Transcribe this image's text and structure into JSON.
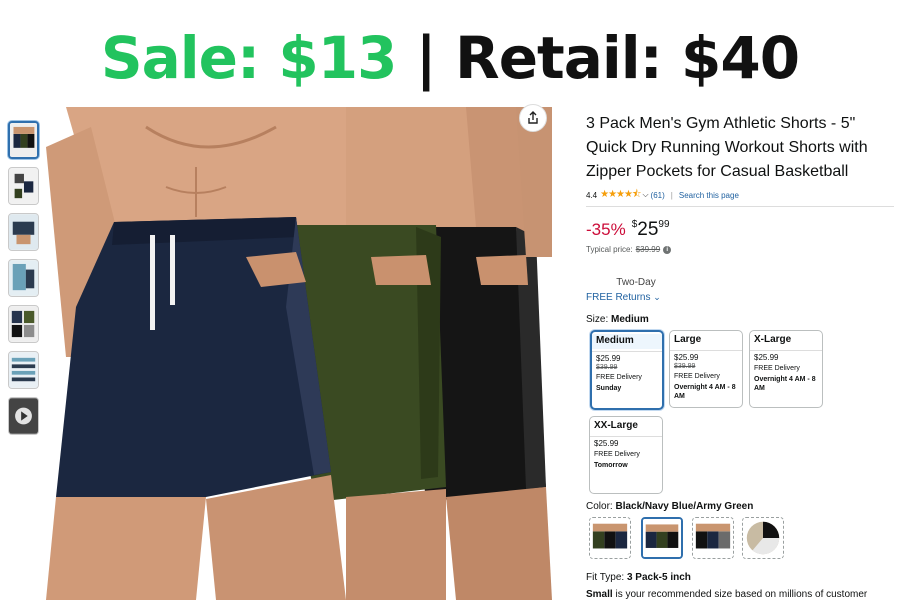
{
  "banner": {
    "sale": "Sale: $13",
    "separator": "|",
    "retail": "Retail: $40",
    "sale_color": "#22c35e",
    "retail_color": "#111111"
  },
  "product": {
    "title": "3 Pack Men's Gym Athletic Shorts - 5\" Quick Dry Running Workout Shorts with Zipper Pockets for Casual Basketball",
    "rating": "4.4",
    "stars": "★★★★⯪",
    "reviews": "(61)",
    "rating_separator": "|",
    "search_link": "Search this page",
    "discount": "-35%",
    "price_symbol": "$",
    "price_whole": "25",
    "price_cents": "99",
    "typical_label": "Typical price:",
    "typical_price": "$39.99",
    "info_icon": "i",
    "shipping_label": "Two-Day",
    "returns_label": "FREE Returns",
    "accent_color": "#2162a1",
    "discount_color": "#cc0c39"
  },
  "size": {
    "label": "Size:",
    "selected": "Medium",
    "options": [
      {
        "name": "Medium",
        "price": "$25.99",
        "original": "$39.99",
        "delivery": "FREE Delivery",
        "when": "Sunday"
      },
      {
        "name": "Large",
        "price": "$25.99",
        "original": "$39.99",
        "delivery": "FREE Delivery",
        "when": "Overnight 4 AM - 8 AM"
      },
      {
        "name": "X-Large",
        "price": "$25.99",
        "original": "",
        "delivery": "FREE Delivery",
        "when": "Overnight 4 AM - 8 AM"
      },
      {
        "name": "XX-Large",
        "price": "$25.99",
        "original": "",
        "delivery": "FREE Delivery",
        "when": "Tomorrow"
      }
    ]
  },
  "color": {
    "label": "Color:",
    "selected": "Black/Navy Blue/Army Green",
    "swatches": [
      "black-green-navy",
      "black-navy-green",
      "black-navy-grey",
      "black-white-khaki"
    ]
  },
  "fit": {
    "label": "Fit Type:",
    "selected": "3 Pack-5 inch"
  },
  "note": {
    "bold": "Small",
    "text": " is your recommended size based on millions of customer"
  },
  "icons": {
    "share": "share-icon",
    "chevron": "chevron-down-icon",
    "play": "play-icon"
  }
}
